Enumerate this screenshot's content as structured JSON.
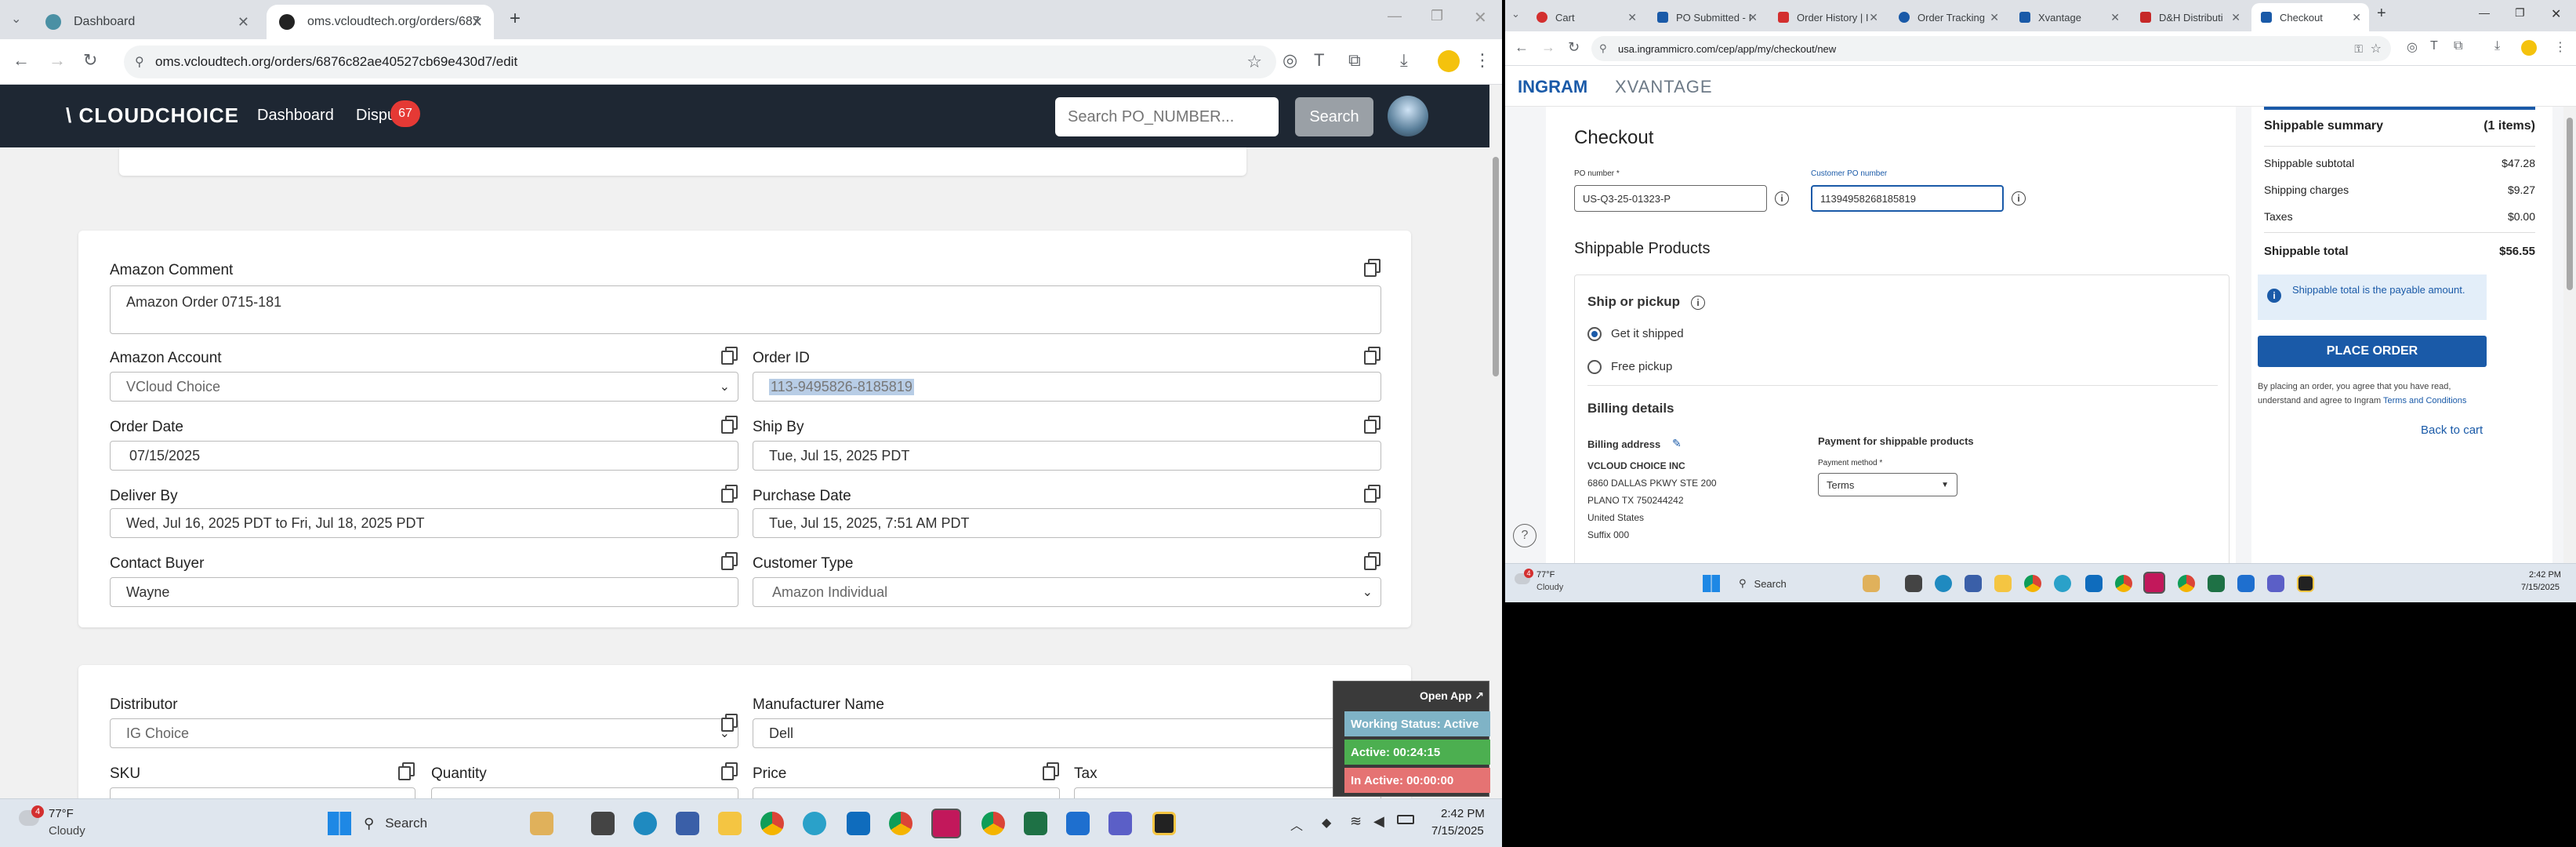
{
  "left": {
    "tabs": [
      {
        "title": "Dashboard",
        "active": false
      },
      {
        "title": "oms.vcloudtech.org/orders/687",
        "active": true
      }
    ],
    "new_tab_icon": "plus-icon",
    "url": "oms.vcloudtech.org/orders/6876c82ae40527cb69e430d7/edit",
    "app": {
      "logo": "\\ CLOUDCHOICE",
      "nav": [
        "Dashboard",
        "Dispu"
      ],
      "badge": "67",
      "search_placeholder": "Search PO_NUMBER...",
      "search_button": "Search"
    },
    "form1": {
      "amazon_comment_label": "Amazon Comment",
      "amazon_comment_value": "Amazon Order 0715-181",
      "amazon_account_label": "Amazon Account",
      "amazon_account_value": "VCloud Choice",
      "order_id_label": "Order ID",
      "order_id_value": "113-9495826-8185819",
      "order_date_label": "Order Date",
      "order_date_value": "07/15/2025",
      "ship_by_label": "Ship By",
      "ship_by_value": "Tue, Jul 15, 2025 PDT",
      "deliver_by_label": "Deliver By",
      "deliver_by_value": "Wed, Jul 16, 2025 PDT to Fri, Jul 18, 2025 PDT",
      "purchase_date_label": "Purchase Date",
      "purchase_date_value": "Tue, Jul 15, 2025, 7:51 AM PDT",
      "contact_buyer_label": "Contact Buyer",
      "contact_buyer_value": "Wayne",
      "customer_type_label": "Customer Type",
      "customer_type_value": "Amazon Individual"
    },
    "form2": {
      "distributor_label": "Distributor",
      "distributor_value": "IG Choice",
      "manufacturer_label": "Manufacturer Name",
      "manufacturer_value": "Dell",
      "sku_label": "SKU",
      "quantity_label": "Quantity",
      "price_label": "Price",
      "tax_label": "Tax"
    },
    "widget": {
      "open_app": "Open App ↗",
      "working_status": "Working Status: Active",
      "active_time": "Active: 00:24:15",
      "inactive_time": "In Active: 00:00:00"
    },
    "taskbar": {
      "weather_temp": "77°F",
      "weather_desc": "Cloudy",
      "search": "Search",
      "time": "2:42 PM",
      "date": "7/15/2025",
      "notif_count": "4"
    }
  },
  "right": {
    "tabs": [
      {
        "title": "Cart"
      },
      {
        "title": "PO Submitted - I"
      },
      {
        "title": "Order History | I"
      },
      {
        "title": "Order Tracking"
      },
      {
        "title": "Xvantage"
      },
      {
        "title": "D&H Distributi"
      },
      {
        "title": "Checkout"
      }
    ],
    "url": "usa.ingrammicro.com/cep/app/my/checkout/new",
    "logo_left": "INGRAM",
    "logo_right": "XVANTAGE",
    "checkout_title": "Checkout",
    "po_number_label": "PO number *",
    "po_number_value": "US-Q3-25-01323-P",
    "customer_po_label": "Customer PO number",
    "customer_po_value": "11394958268185819",
    "shippable_products": "Shippable Products",
    "ship_or_pickup": "Ship or pickup",
    "get_it_shipped": "Get it shipped",
    "free_pickup": "Free pickup",
    "billing_details": "Billing details",
    "billing_address": "Billing address",
    "address_lines": [
      "VCLOUD CHOICE INC",
      "6860 DALLAS PKWY STE 200",
      "PLANO TX 750244242",
      "United States",
      "Suffix 000"
    ],
    "payment_title": "Payment for shippable products",
    "payment_method_label": "Payment method *",
    "payment_method_value": "Terms",
    "summary": {
      "title": "Shippable summary",
      "items": "(1 items)",
      "subtotal_label": "Shippable subtotal",
      "subtotal": "$47.28",
      "shipping_label": "Shipping charges",
      "shipping": "$9.27",
      "taxes_label": "Taxes",
      "taxes": "$0.00",
      "total_label": "Shippable total",
      "total": "$56.55",
      "note": "Shippable total is the payable amount.",
      "place_order": "PLACE ORDER",
      "terms_text": "By placing an order, you agree that you have read, understand and agree to Ingram",
      "terms_link": "Terms and Conditions",
      "back_to_cart": "Back to cart"
    },
    "taskbar": {
      "weather_temp": "77°F",
      "weather_desc": "Cloudy",
      "search": "Search",
      "time": "2:42 PM",
      "date": "7/15/2025",
      "notif_count": "4"
    }
  }
}
